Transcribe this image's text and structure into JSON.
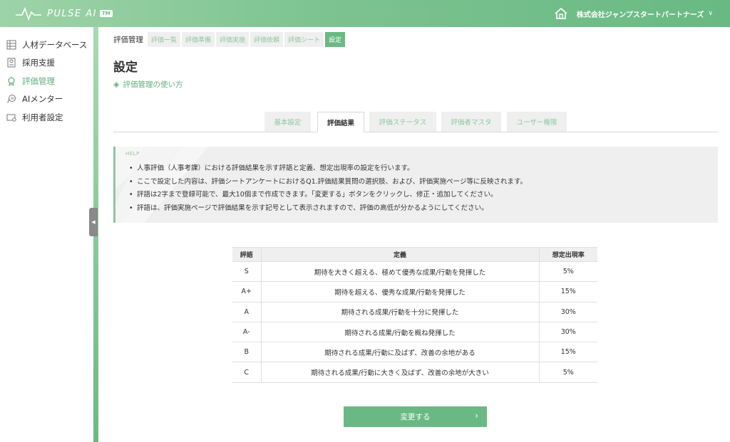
{
  "header": {
    "logo_text": "PULSE AI",
    "logo_tm": "TM",
    "company": "株式会社ジャンプスタートパートナーズ",
    "company_caret": "∨",
    "home_icon": "home-icon"
  },
  "sidebar": {
    "items": [
      {
        "label": "人材データベース",
        "icon": "database-icon"
      },
      {
        "label": "採用支援",
        "icon": "document-icon"
      },
      {
        "label": "評価管理",
        "icon": "award-icon",
        "active": true
      },
      {
        "label": "AIメンター",
        "icon": "mentor-icon"
      },
      {
        "label": "利用者設定",
        "icon": "user-settings-icon"
      }
    ],
    "collapse_glyph": "◀"
  },
  "breadcrumb": {
    "root": "評価管理",
    "items": [
      "評価一覧",
      "評価準備",
      "評価実施",
      "評価依頼",
      "評価シート",
      "設定"
    ]
  },
  "page": {
    "title": "設定",
    "howto_label": "評価管理の使い方",
    "howto_icon": "◈"
  },
  "tabs": [
    "基本設定",
    "評価結果",
    "評価ステータス",
    "評価者マスタ",
    "ユーザー権限"
  ],
  "active_tab": "評価結果",
  "help": {
    "label": "HELP",
    "items": [
      "人事評価（人事考課）における評価結果を示す評語と定義、想定出現率の設定を行います。",
      "ここで設定した内容は、評価シートアンケートにおけるQ1.評価結果質問の選択肢、および、評価実施ページ等に反映されます。",
      "評語は2字まで登録可能で、最大10個まで作成できます。「変更する」ボタンをクリックし、修正・追加してください。",
      "評語は、評価実施ページで評価結果を示す記号として表示されますので、評価の高低が分かるようにしてください。"
    ]
  },
  "table": {
    "headers": [
      "評語",
      "定義",
      "想定出現率"
    ],
    "rows": [
      [
        "S",
        "期待を大きく超える、極めて優秀な成果/行動を発揮した",
        "5%"
      ],
      [
        "A+",
        "期待を超える、優秀な成果/行動を発揮した",
        "15%"
      ],
      [
        "A",
        "期待される成果/行動を十分に発揮した",
        "30%"
      ],
      [
        "A-",
        "期待される成果/行動を概ね発揮した",
        "30%"
      ],
      [
        "B",
        "期待される成果/行動に及ばず、改善の余地がある",
        "15%"
      ],
      [
        "C",
        "期待される成果/行動に大きく及ばず、改善の余地が大きい",
        "5%"
      ]
    ]
  },
  "buttons": {
    "change_label": "変更する",
    "change_chevron": "›"
  },
  "colors": {
    "accent": "#6ab984",
    "accent_light": "#8fc6a0",
    "panel_bg": "#efefef"
  }
}
